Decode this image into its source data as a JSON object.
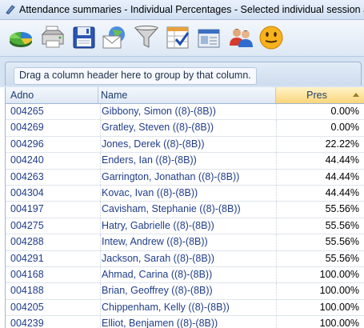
{
  "window": {
    "title": "Attendance summaries - Individual Percentages - Selected individual session att"
  },
  "toolbar": {
    "buttons": [
      {
        "icon": "chart-icon"
      },
      {
        "icon": "printer-icon"
      },
      {
        "icon": "save-icon"
      },
      {
        "icon": "email-icon"
      },
      {
        "icon": "filter-icon"
      },
      {
        "icon": "checklist-icon"
      },
      {
        "icon": "address-book-icon"
      },
      {
        "icon": "users-icon"
      },
      {
        "icon": "smiley-icon"
      }
    ]
  },
  "group_panel": {
    "hint": "Drag a column header here to group by that column."
  },
  "table": {
    "columns": [
      "Adno",
      "Name",
      "Pres"
    ],
    "sorted_column": "Pres",
    "rows": [
      {
        "adno": "004265",
        "name": "Gibbony, Simon ((8)-(8B))",
        "pres": "0.00%"
      },
      {
        "adno": "004269",
        "name": "Gratley, Steven ((8)-(8B))",
        "pres": "0.00%"
      },
      {
        "adno": "004296",
        "name": "Jones, Derek ((8)-(8B))",
        "pres": "22.22%"
      },
      {
        "adno": "004240",
        "name": "Enders, Ian ((8)-(8B))",
        "pres": "44.44%"
      },
      {
        "adno": "004263",
        "name": "Garrington, Jonathan ((8)-(8B))",
        "pres": "44.44%"
      },
      {
        "adno": "004304",
        "name": "Kovac, Ivan ((8)-(8B))",
        "pres": "44.44%"
      },
      {
        "adno": "004197",
        "name": "Cavisham, Stephanie ((8)-(8B))",
        "pres": "55.56%"
      },
      {
        "adno": "004275",
        "name": "Hatry, Gabrielle ((8)-(8B))",
        "pres": "55.56%"
      },
      {
        "adno": "004288",
        "name": "Intew, Andrew ((8)-(8B))",
        "pres": "55.56%"
      },
      {
        "adno": "004291",
        "name": "Jackson, Sarah ((8)-(8B))",
        "pres": "55.56%"
      },
      {
        "adno": "004168",
        "name": "Ahmad, Carina ((8)-(8B))",
        "pres": "100.00%"
      },
      {
        "adno": "004188",
        "name": "Brian, Geoffrey ((8)-(8B))",
        "pres": "100.00%"
      },
      {
        "adno": "004205",
        "name": "Chippenham, Kelly ((8)-(8B))",
        "pres": "100.00%"
      },
      {
        "adno": "004239",
        "name": "Elliot, Benjamen ((8)-(8B))",
        "pres": "100.00%"
      }
    ]
  },
  "colors": {
    "accent": "#fad67b",
    "text_link": "#1f3d8a",
    "panel": "#d6e3f3"
  }
}
